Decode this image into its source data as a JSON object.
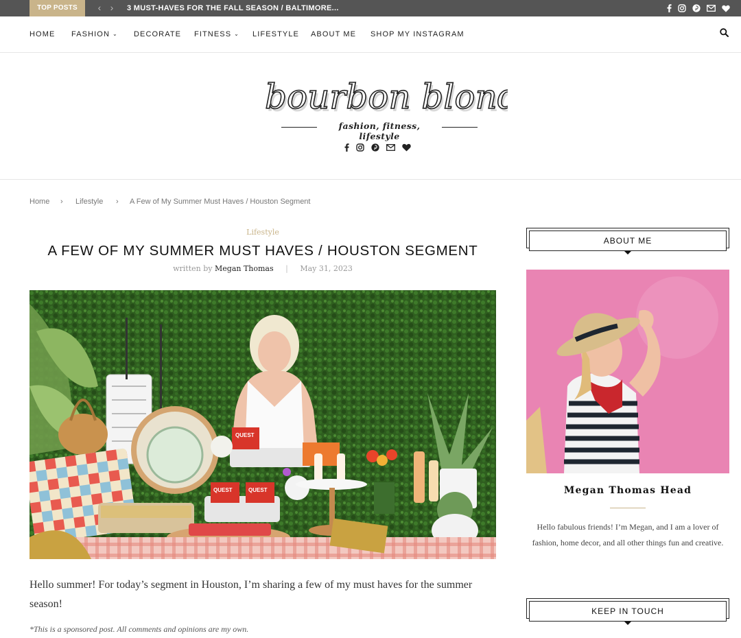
{
  "topbar": {
    "badge": "TOP POSTS",
    "prev_arrow": "‹",
    "next_arrow": "›",
    "headline": "3 MUST-HAVES FOR THE FALL SEASON / BALTIMORE...",
    "social_icons": [
      "facebook-icon",
      "instagram-icon",
      "pinterest-icon",
      "email-icon",
      "heart-icon"
    ]
  },
  "nav": {
    "items": [
      {
        "label": "HOME",
        "dropdown": false
      },
      {
        "label": "FASHION",
        "dropdown": true
      },
      {
        "label": "DECORATE",
        "dropdown": false
      },
      {
        "label": "FITNESS",
        "dropdown": true
      },
      {
        "label": "LIFESTYLE",
        "dropdown": false
      },
      {
        "label": "ABOUT ME",
        "dropdown": false
      },
      {
        "label": "SHOP MY INSTAGRAM",
        "dropdown": false
      }
    ],
    "dropdown_glyph": "⌄",
    "search_icon": "search-icon"
  },
  "header": {
    "logo_text": "bourbon blonde",
    "tagline": "fashion, fitness, lifestyle",
    "social_icons": [
      "facebook-icon",
      "instagram-icon",
      "pinterest-icon",
      "email-icon",
      "heart-icon"
    ]
  },
  "breadcrumb": {
    "items": [
      "Home",
      "Lifestyle",
      "A Few of My Summer Must Haves / Houston Segment"
    ],
    "separator": "›"
  },
  "post": {
    "category": "Lifestyle",
    "title": "A FEW OF MY SUMMER MUST HAVES / HOUSTON SEGMENT",
    "written_by": "written by",
    "author": "Megan Thomas",
    "date": "May 31, 2023",
    "body": "Hello summer! For today’s segment in Houston, I’m sharing a few of my must haves for the summer season!",
    "disclaimer": "*This is a sponsored post. All comments and opinions are my own.",
    "product_label": "QUEST"
  },
  "sidebar": {
    "about_title": "ABOUT ME",
    "about_name": "Megan Thomas Head",
    "about_text": "Hello fabulous friends! I’m Megan, and I am a lover of fashion, home decor, and all other things fun and creative.",
    "keep_title": "KEEP IN TOUCH"
  },
  "colors": {
    "accent": "#c9b48a",
    "topbar": "#555555",
    "text": "#222222"
  }
}
